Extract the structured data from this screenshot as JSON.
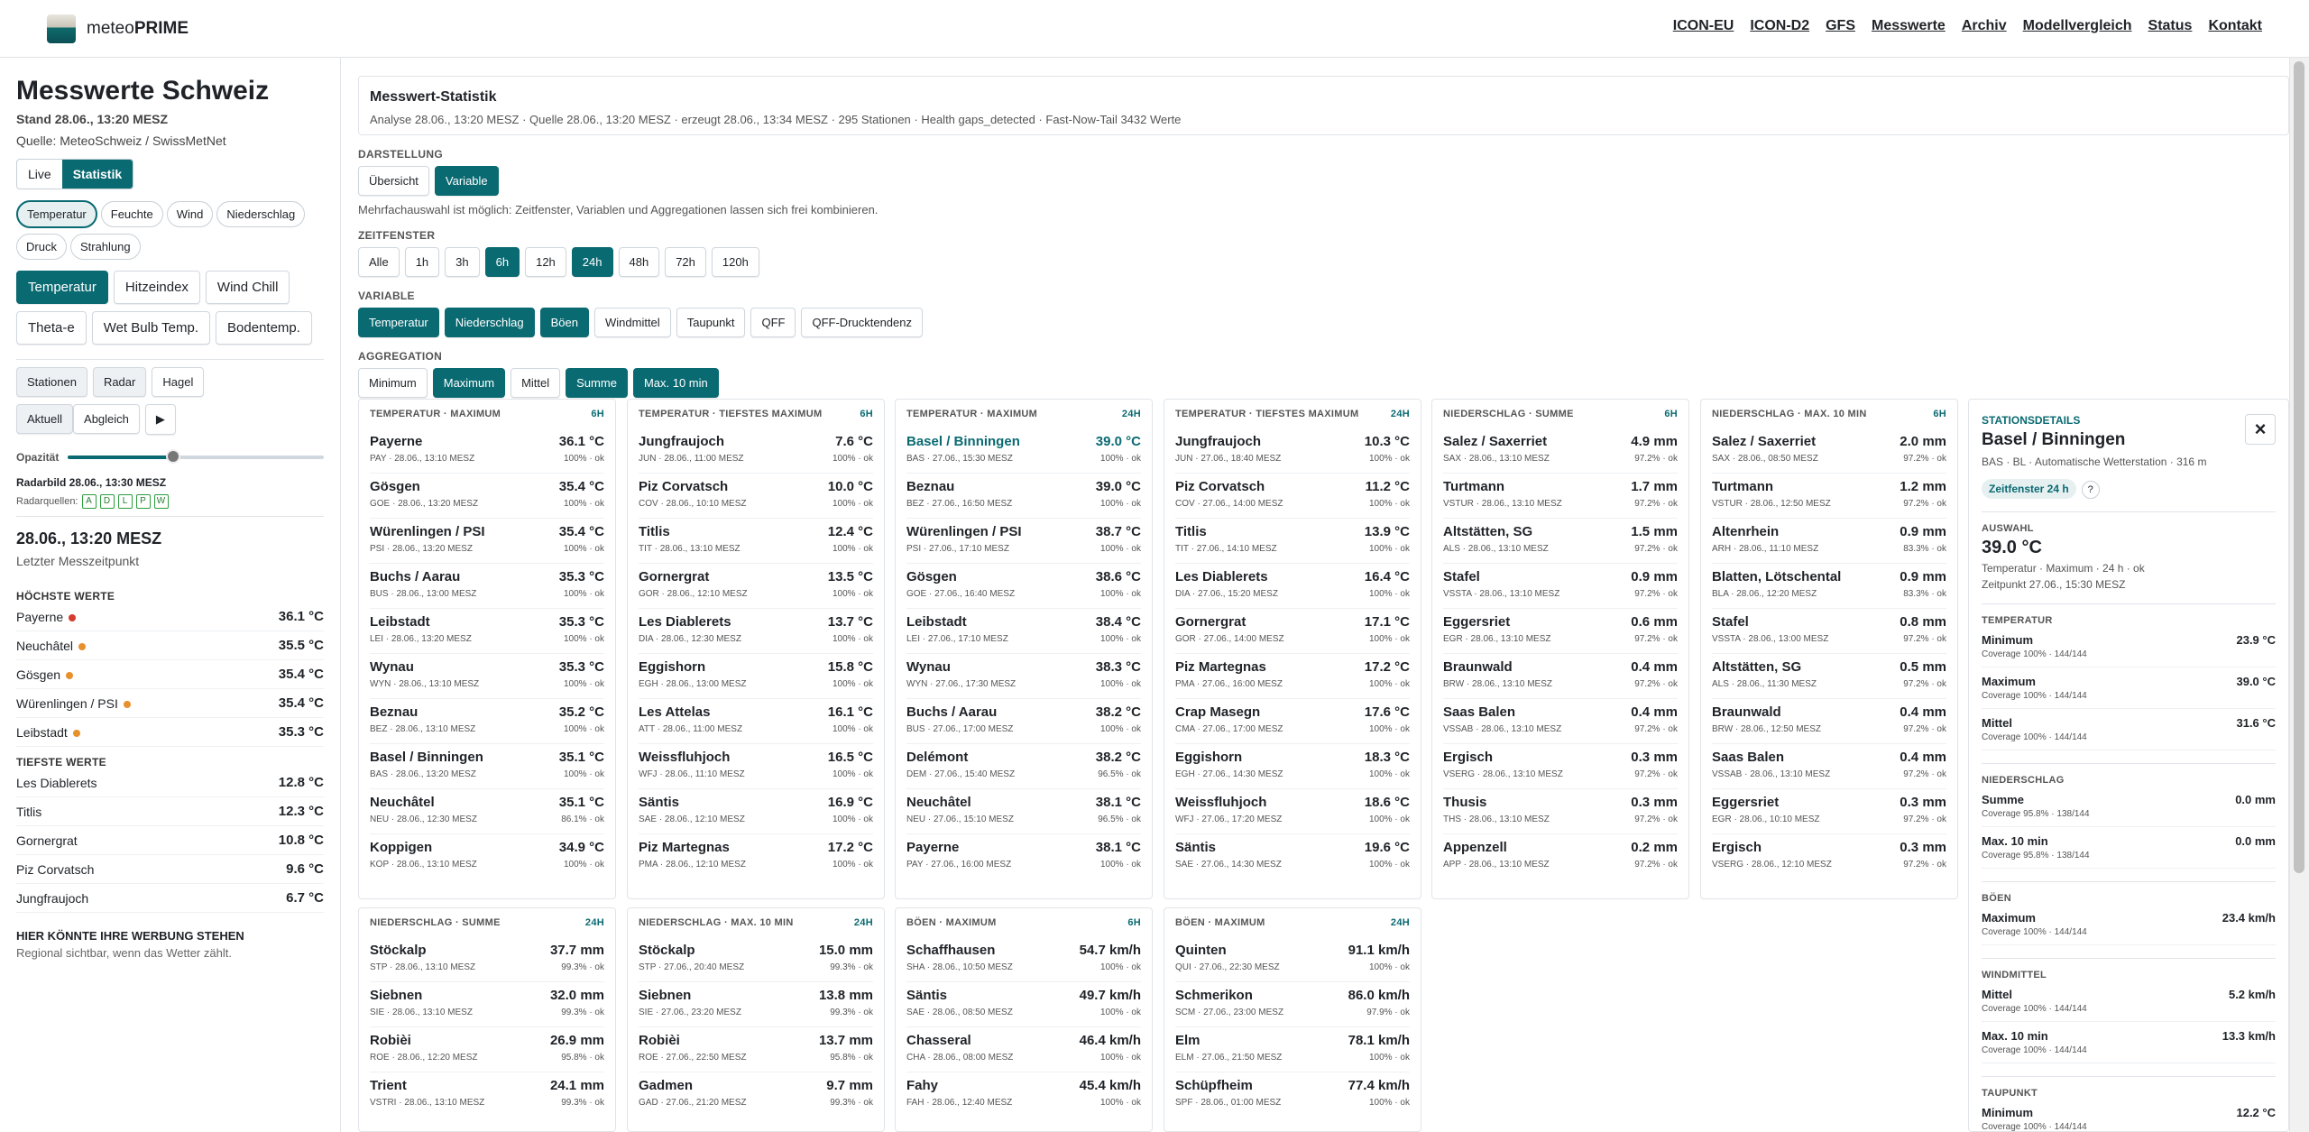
{
  "brand": {
    "prefix": "meteo",
    "name": "PRIME"
  },
  "nav": [
    "ICON-EU",
    "ICON-D2",
    "GFS",
    "Messwerte",
    "Archiv",
    "Modellvergleich",
    "Status",
    "Kontakt"
  ],
  "left": {
    "title": "Messwerte Schweiz",
    "stand": "Stand 28.06., 13:20 MESZ",
    "quelle": "Quelle: MeteoSchweiz / SwissMetNet",
    "mode": [
      "Live",
      "Statistik"
    ],
    "params": [
      "Temperatur",
      "Feuchte",
      "Wind",
      "Niederschlag",
      "Druck",
      "Strahlung"
    ],
    "subparams": [
      "Temperatur",
      "Hitzeindex",
      "Wind Chill",
      "Theta-e",
      "Wet Bulb Temp.",
      "Bodentemp."
    ],
    "layers": [
      "Stationen",
      "Radar",
      "Hagel"
    ],
    "radarmode": [
      "Aktuell",
      "Abgleich",
      "▶"
    ],
    "opacity_label": "Opazität",
    "opacity": 0.41,
    "radarbild": "Radarbild 28.06., 13:30 MESZ",
    "radarquellen_label": "Radarquellen:",
    "radarquellen": [
      "A",
      "D",
      "L",
      "P",
      "W"
    ],
    "timestamp": "28.06., 13:20 MESZ",
    "timestamp_sub": "Letzter Messzeitpunkt",
    "highest_title": "HÖCHSTE WERTE",
    "highest": [
      {
        "name": "Payerne",
        "value": "36.1 °C",
        "color": "#d63b2f"
      },
      {
        "name": "Neuchâtel",
        "value": "35.5 °C",
        "color": "#e8902c"
      },
      {
        "name": "Gösgen",
        "value": "35.4 °C",
        "color": "#e8902c"
      },
      {
        "name": "Würenlingen / PSI",
        "value": "35.4 °C",
        "color": "#e8902c"
      },
      {
        "name": "Leibstadt",
        "value": "35.3 °C",
        "color": "#e8902c"
      }
    ],
    "lowest_title": "TIEFSTE WERTE",
    "lowest": [
      {
        "name": "Les Diablerets",
        "value": "12.8 °C"
      },
      {
        "name": "Titlis",
        "value": "12.3 °C"
      },
      {
        "name": "Gornergrat",
        "value": "10.8 °C"
      },
      {
        "name": "Piz Corvatsch",
        "value": "9.6 °C"
      },
      {
        "name": "Jungfraujoch",
        "value": "6.7 °C"
      }
    ],
    "ad_title": "HIER KÖNNTE IHRE WERBUNG STEHEN",
    "ad_sub": "Regional sichtbar, wenn das Wetter zählt."
  },
  "stat": {
    "title": "Messwert-Statistik",
    "sub": "Analyse 28.06., 13:20 MESZ · Quelle 28.06., 13:20 MESZ · erzeugt 28.06., 13:34 MESZ · 295 Stationen · Health gaps_detected · Fast-Now-Tail 3432 Werte"
  },
  "darstellung": {
    "label": "DARSTELLUNG",
    "opts": [
      "Übersicht",
      "Variable"
    ]
  },
  "hint": "Mehrfachauswahl ist möglich: Zeitfenster, Variablen und Aggregationen lassen sich frei kombinieren.",
  "zeitfenster": {
    "label": "ZEITFENSTER",
    "opts": [
      "Alle",
      "1h",
      "3h",
      "6h",
      "12h",
      "24h",
      "48h",
      "72h",
      "120h"
    ]
  },
  "variable": {
    "label": "VARIABLE",
    "opts": [
      "Temperatur",
      "Niederschlag",
      "Böen",
      "Windmittel",
      "Taupunkt",
      "QFF",
      "QFF-Drucktendenz"
    ]
  },
  "aggregation": {
    "label": "AGGREGATION",
    "opts": [
      "Minimum",
      "Maximum",
      "Mittel",
      "Summe",
      "Max. 10 min"
    ]
  },
  "cards": [
    {
      "title": "TEMPERATUR · MAXIMUM",
      "period": "6H",
      "items": [
        [
          "Payerne",
          "36.1 °C",
          "PAY · 28.06., 13:10 MESZ",
          "100% · ok"
        ],
        [
          "Gösgen",
          "35.4 °C",
          "GOE · 28.06., 13:20 MESZ",
          "100% · ok"
        ],
        [
          "Würenlingen / PSI",
          "35.4 °C",
          "PSI · 28.06., 13:20 MESZ",
          "100% · ok"
        ],
        [
          "Buchs / Aarau",
          "35.3 °C",
          "BUS · 28.06., 13:00 MESZ",
          "100% · ok"
        ],
        [
          "Leibstadt",
          "35.3 °C",
          "LEI · 28.06., 13:20 MESZ",
          "100% · ok"
        ],
        [
          "Wynau",
          "35.3 °C",
          "WYN · 28.06., 13:10 MESZ",
          "100% · ok"
        ],
        [
          "Beznau",
          "35.2 °C",
          "BEZ · 28.06., 13:10 MESZ",
          "100% · ok"
        ],
        [
          "Basel / Binningen",
          "35.1 °C",
          "BAS · 28.06., 13:20 MESZ",
          "100% · ok"
        ],
        [
          "Neuchâtel",
          "35.1 °C",
          "NEU · 28.06., 12:30 MESZ",
          "86.1% · ok"
        ],
        [
          "Koppigen",
          "34.9 °C",
          "KOP · 28.06., 13:10 MESZ",
          "100% · ok"
        ]
      ]
    },
    {
      "title": "TEMPERATUR · TIEFSTES MAXIMUM",
      "period": "6H",
      "items": [
        [
          "Jungfraujoch",
          "7.6 °C",
          "JUN · 28.06., 11:00 MESZ",
          "100% · ok"
        ],
        [
          "Piz Corvatsch",
          "10.0 °C",
          "COV · 28.06., 10:10 MESZ",
          "100% · ok"
        ],
        [
          "Titlis",
          "12.4 °C",
          "TIT · 28.06., 13:10 MESZ",
          "100% · ok"
        ],
        [
          "Gornergrat",
          "13.5 °C",
          "GOR · 28.06., 12:10 MESZ",
          "100% · ok"
        ],
        [
          "Les Diablerets",
          "13.7 °C",
          "DIA · 28.06., 12:30 MESZ",
          "100% · ok"
        ],
        [
          "Eggishorn",
          "15.8 °C",
          "EGH · 28.06., 13:00 MESZ",
          "100% · ok"
        ],
        [
          "Les Attelas",
          "16.1 °C",
          "ATT · 28.06., 11:00 MESZ",
          "100% · ok"
        ],
        [
          "Weissfluhjoch",
          "16.5 °C",
          "WFJ · 28.06., 11:10 MESZ",
          "100% · ok"
        ],
        [
          "Säntis",
          "16.9 °C",
          "SAE · 28.06., 12:10 MESZ",
          "100% · ok"
        ],
        [
          "Piz Martegnas",
          "17.2 °C",
          "PMA · 28.06., 12:10 MESZ",
          "100% · ok"
        ]
      ]
    },
    {
      "title": "TEMPERATUR · MAXIMUM",
      "period": "24H",
      "items": [
        [
          "Basel / Binningen",
          "39.0 °C",
          "BAS · 27.06., 15:30 MESZ",
          "100% · ok"
        ],
        [
          "Beznau",
          "39.0 °C",
          "BEZ · 27.06., 16:50 MESZ",
          "100% · ok"
        ],
        [
          "Würenlingen / PSI",
          "38.7 °C",
          "PSI · 27.06., 17:10 MESZ",
          "100% · ok"
        ],
        [
          "Gösgen",
          "38.6 °C",
          "GOE · 27.06., 16:40 MESZ",
          "100% · ok"
        ],
        [
          "Leibstadt",
          "38.4 °C",
          "LEI · 27.06., 17:10 MESZ",
          "100% · ok"
        ],
        [
          "Wynau",
          "38.3 °C",
          "WYN · 27.06., 17:30 MESZ",
          "100% · ok"
        ],
        [
          "Buchs / Aarau",
          "38.2 °C",
          "BUS · 27.06., 17:00 MESZ",
          "100% · ok"
        ],
        [
          "Delémont",
          "38.2 °C",
          "DEM · 27.06., 15:40 MESZ",
          "96.5% · ok"
        ],
        [
          "Neuchâtel",
          "38.1 °C",
          "NEU · 27.06., 15:10 MESZ",
          "96.5% · ok"
        ],
        [
          "Payerne",
          "38.1 °C",
          "PAY · 27.06., 16:00 MESZ",
          "100% · ok"
        ]
      ]
    },
    {
      "title": "TEMPERATUR · TIEFSTES MAXIMUM",
      "period": "24H",
      "items": [
        [
          "Jungfraujoch",
          "10.3 °C",
          "JUN · 27.06., 18:40 MESZ",
          "100% · ok"
        ],
        [
          "Piz Corvatsch",
          "11.2 °C",
          "COV · 27.06., 14:00 MESZ",
          "100% · ok"
        ],
        [
          "Titlis",
          "13.9 °C",
          "TIT · 27.06., 14:10 MESZ",
          "100% · ok"
        ],
        [
          "Les Diablerets",
          "16.4 °C",
          "DIA · 27.06., 15:20 MESZ",
          "100% · ok"
        ],
        [
          "Gornergrat",
          "17.1 °C",
          "GOR · 27.06., 14:00 MESZ",
          "100% · ok"
        ],
        [
          "Piz Martegnas",
          "17.2 °C",
          "PMA · 27.06., 16:00 MESZ",
          "100% · ok"
        ],
        [
          "Crap Masegn",
          "17.6 °C",
          "CMA · 27.06., 17:00 MESZ",
          "100% · ok"
        ],
        [
          "Eggishorn",
          "18.3 °C",
          "EGH · 27.06., 14:30 MESZ",
          "100% · ok"
        ],
        [
          "Weissfluhjoch",
          "18.6 °C",
          "WFJ · 27.06., 17:20 MESZ",
          "100% · ok"
        ],
        [
          "Säntis",
          "19.6 °C",
          "SAE · 27.06., 14:30 MESZ",
          "100% · ok"
        ]
      ]
    },
    {
      "title": "NIEDERSCHLAG · SUMME",
      "period": "6H",
      "items": [
        [
          "Salez / Saxerriet",
          "4.9 mm",
          "SAX · 28.06., 13:10 MESZ",
          "97.2% · ok"
        ],
        [
          "Turtmann",
          "1.7 mm",
          "VSTUR · 28.06., 13:10 MESZ",
          "97.2% · ok"
        ],
        [
          "Altstätten, SG",
          "1.5 mm",
          "ALS · 28.06., 13:10 MESZ",
          "97.2% · ok"
        ],
        [
          "Stafel",
          "0.9 mm",
          "VSSTA · 28.06., 13:10 MESZ",
          "97.2% · ok"
        ],
        [
          "Eggersriet",
          "0.6 mm",
          "EGR · 28.06., 13:10 MESZ",
          "97.2% · ok"
        ],
        [
          "Braunwald",
          "0.4 mm",
          "BRW · 28.06., 13:10 MESZ",
          "97.2% · ok"
        ],
        [
          "Saas Balen",
          "0.4 mm",
          "VSSAB · 28.06., 13:10 MESZ",
          "97.2% · ok"
        ],
        [
          "Ergisch",
          "0.3 mm",
          "VSERG · 28.06., 13:10 MESZ",
          "97.2% · ok"
        ],
        [
          "Thusis",
          "0.3 mm",
          "THS · 28.06., 13:10 MESZ",
          "97.2% · ok"
        ],
        [
          "Appenzell",
          "0.2 mm",
          "APP · 28.06., 13:10 MESZ",
          "97.2% · ok"
        ]
      ]
    },
    {
      "title": "NIEDERSCHLAG · MAX. 10 MIN",
      "period": "6H",
      "items": [
        [
          "Salez / Saxerriet",
          "2.0 mm",
          "SAX · 28.06., 08:50 MESZ",
          "97.2% · ok"
        ],
        [
          "Turtmann",
          "1.2 mm",
          "VSTUR · 28.06., 12:50 MESZ",
          "97.2% · ok"
        ],
        [
          "Altenrhein",
          "0.9 mm",
          "ARH · 28.06., 11:10 MESZ",
          "83.3% · ok"
        ],
        [
          "Blatten, Lötschental",
          "0.9 mm",
          "BLA · 28.06., 12:20 MESZ",
          "83.3% · ok"
        ],
        [
          "Stafel",
          "0.8 mm",
          "VSSTA · 28.06., 13:00 MESZ",
          "97.2% · ok"
        ],
        [
          "Altstätten, SG",
          "0.5 mm",
          "ALS · 28.06., 11:30 MESZ",
          "97.2% · ok"
        ],
        [
          "Braunwald",
          "0.4 mm",
          "BRW · 28.06., 12:50 MESZ",
          "97.2% · ok"
        ],
        [
          "Saas Balen",
          "0.4 mm",
          "VSSAB · 28.06., 13:10 MESZ",
          "97.2% · ok"
        ],
        [
          "Eggersriet",
          "0.3 mm",
          "EGR · 28.06., 10:10 MESZ",
          "97.2% · ok"
        ],
        [
          "Ergisch",
          "0.3 mm",
          "VSERG · 28.06., 12:10 MESZ",
          "97.2% · ok"
        ]
      ]
    },
    {
      "title": "NIEDERSCHLAG · SUMME",
      "period": "24H",
      "items": [
        [
          "Stöckalp",
          "37.7 mm",
          "STP · 28.06., 13:10 MESZ",
          "99.3% · ok"
        ],
        [
          "Siebnen",
          "32.0 mm",
          "SIE · 28.06., 13:10 MESZ",
          "99.3% · ok"
        ],
        [
          "Robièi",
          "26.9 mm",
          "ROE · 28.06., 12:20 MESZ",
          "95.8% · ok"
        ],
        [
          "Trient",
          "24.1 mm",
          "VSTRI · 28.06., 13:10 MESZ",
          "99.3% · ok"
        ]
      ]
    },
    {
      "title": "NIEDERSCHLAG · MAX. 10 MIN",
      "period": "24H",
      "items": [
        [
          "Stöckalp",
          "15.0 mm",
          "STP · 27.06., 20:40 MESZ",
          "99.3% · ok"
        ],
        [
          "Siebnen",
          "13.8 mm",
          "SIE · 27.06., 23:20 MESZ",
          "99.3% · ok"
        ],
        [
          "Robièi",
          "13.7 mm",
          "ROE · 27.06., 22:50 MESZ",
          "95.8% · ok"
        ],
        [
          "Gadmen",
          "9.7 mm",
          "GAD · 27.06., 21:20 MESZ",
          "99.3% · ok"
        ]
      ]
    },
    {
      "title": "BÖEN · MAXIMUM",
      "period": "6H",
      "items": [
        [
          "Schaffhausen",
          "54.7 km/h",
          "SHA · 28.06., 10:50 MESZ",
          "100% · ok"
        ],
        [
          "Säntis",
          "49.7 km/h",
          "SAE · 28.06., 08:50 MESZ",
          "100% · ok"
        ],
        [
          "Chasseral",
          "46.4 km/h",
          "CHA · 28.06., 08:00 MESZ",
          "100% · ok"
        ],
        [
          "Fahy",
          "45.4 km/h",
          "FAH · 28.06., 12:40 MESZ",
          "100% · ok"
        ]
      ]
    },
    {
      "title": "BÖEN · MAXIMUM",
      "period": "24H",
      "items": [
        [
          "Quinten",
          "91.1 km/h",
          "QUI · 27.06., 22:30 MESZ",
          "100% · ok"
        ],
        [
          "Schmerikon",
          "86.0 km/h",
          "SCM · 27.06., 23:00 MESZ",
          "97.9% · ok"
        ],
        [
          "Elm",
          "78.1 km/h",
          "ELM · 27.06., 21:50 MESZ",
          "100% · ok"
        ],
        [
          "Schüpfheim",
          "77.4 km/h",
          "SPF · 28.06., 01:00 MESZ",
          "100% · ok"
        ]
      ]
    }
  ],
  "detail": {
    "kicker": "STATIONSDETAILS",
    "name": "Basel / Binningen",
    "sub": "BAS · BL · Automatische Wetterstation · 316 m",
    "tag": "Zeitfenster 24 h",
    "qm": "?",
    "close": "×",
    "auswahl_label": "AUSWAHL",
    "auswahl_value": "39.0 °C",
    "auswahl_desc": "Temperatur · Maximum · 24 h · ok",
    "auswahl_time": "Zeitpunkt 27.06., 15:30 MESZ",
    "sections": [
      {
        "title": "TEMPERATUR",
        "rows": [
          [
            "Minimum",
            "23.9 °C",
            "Coverage 100% · 144/144"
          ],
          [
            "Maximum",
            "39.0 °C",
            "Coverage 100% · 144/144"
          ],
          [
            "Mittel",
            "31.6 °C",
            "Coverage 100% · 144/144"
          ]
        ]
      },
      {
        "title": "NIEDERSCHLAG",
        "rows": [
          [
            "Summe",
            "0.0 mm",
            "Coverage 95.8% · 138/144"
          ],
          [
            "Max. 10 min",
            "0.0 mm",
            "Coverage 95.8% · 138/144"
          ]
        ]
      },
      {
        "title": "BÖEN",
        "rows": [
          [
            "Maximum",
            "23.4 km/h",
            "Coverage 100% · 144/144"
          ]
        ]
      },
      {
        "title": "WINDMITTEL",
        "rows": [
          [
            "Mittel",
            "5.2 km/h",
            "Coverage 100% · 144/144"
          ],
          [
            "Max. 10 min",
            "13.3 km/h",
            "Coverage 100% · 144/144"
          ]
        ]
      },
      {
        "title": "TAUPUNKT",
        "rows": [
          [
            "Minimum",
            "12.2 °C",
            "Coverage 100% · 144/144"
          ]
        ]
      }
    ]
  }
}
